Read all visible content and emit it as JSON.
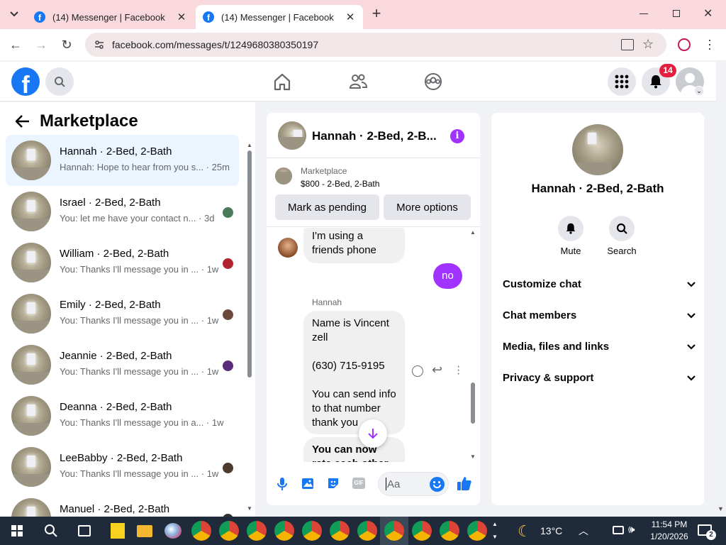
{
  "browser": {
    "tabs": [
      {
        "title": "(14) Messenger | Facebook"
      },
      {
        "title": "(14) Messenger | Facebook"
      }
    ],
    "url": "facebook.com/messages/t/1249680380350197"
  },
  "header": {
    "notifications_count": "14"
  },
  "left": {
    "title": "Marketplace",
    "chats": [
      {
        "name": "Hannah · 2-Bed, 2-Bath",
        "preview": "Hannah: Hope to hear from you s... · 25m",
        "selected": true
      },
      {
        "name": "Israel · 2-Bed, 2-Bath",
        "preview": "You: let me have your contact n... · 3d"
      },
      {
        "name": "William · 2-Bed, 2-Bath",
        "preview": "You: Thanks I'll message you in ... · 1w"
      },
      {
        "name": "Emily · 2-Bed, 2-Bath",
        "preview": "You: Thanks I'll message you in ... · 1w"
      },
      {
        "name": "Jeannie · 2-Bed, 2-Bath",
        "preview": "You: Thanks I'll message you in ... · 1w"
      },
      {
        "name": "Deanna · 2-Bed, 2-Bath",
        "preview": "You: Thanks I'll message you in a... · 1w"
      },
      {
        "name": "LeeBabby · 2-Bed, 2-Bath",
        "preview": "You: Thanks I'll message you in ... · 1w"
      },
      {
        "name": "Manuel · 2-Bed, 2-Bath",
        "preview": ""
      }
    ]
  },
  "chat": {
    "title": "Hannah · 2-Bed, 2-B...",
    "listing_label": "Marketplace",
    "listing_detail": "$800 - 2-Bed, 2-Bath",
    "mark_pending": "Mark as pending",
    "more_options": "More options",
    "msg1": "I'm using a\nfriends phone",
    "msg_me": "no",
    "sender": "Hannah",
    "msg2": "Name is Vincent\nzell\n\n(630) 715-9195\n\nYou can send info\nto that number\nthank you",
    "msg3": "You can now\nrate each other",
    "input_placeholder": "Aa"
  },
  "info": {
    "name": "Hannah · 2-Bed, 2-Bath",
    "mute": "Mute",
    "search": "Search",
    "sections": [
      "Customize chat",
      "Chat members",
      "Media, files and links",
      "Privacy & support"
    ]
  },
  "taskbar": {
    "temperature": "13°C",
    "time": "11:54 PM",
    "date": "1/20/2026",
    "notif": "2"
  },
  "colors": {
    "fb_blue": "#1877f2",
    "messenger_purple": "#a033ff",
    "badge_red": "#e41e3f"
  }
}
